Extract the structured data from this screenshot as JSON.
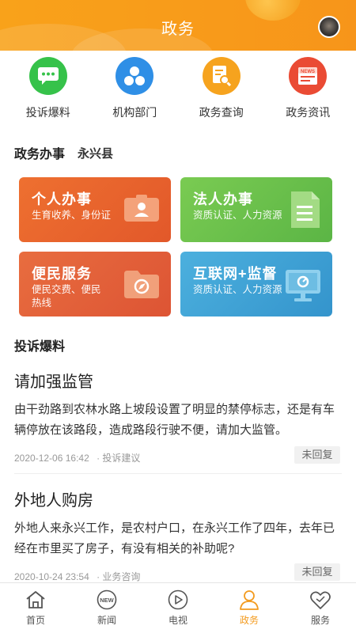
{
  "header": {
    "title": "政务"
  },
  "quick": [
    {
      "label": "投诉爆料",
      "icon": "chat-bubble-icon",
      "color": "#36c24a"
    },
    {
      "label": "机构部门",
      "icon": "org-circles-icon",
      "color": "#2f8fe6"
    },
    {
      "label": "政务查询",
      "icon": "document-search-icon",
      "color": "#f6a31e"
    },
    {
      "label": "政务资讯",
      "icon": "news-icon",
      "color": "#ea4b34"
    }
  ],
  "affairs": {
    "title": "政务办事",
    "county": "永兴县",
    "cards": [
      {
        "title": "个人办事",
        "desc": "生育收养、身份证",
        "icon": "id-card-icon",
        "color": "#e8602c"
      },
      {
        "title": "法人办事",
        "desc": "资质认证、人力资源",
        "icon": "document-icon",
        "color": "#6cc04a"
      },
      {
        "title": "便民服务",
        "desc": "便民交费、便民热线",
        "icon": "folder-icon",
        "color": "#e2603a"
      },
      {
        "title": "互联网+监督",
        "desc": "资质认证、人力资源",
        "icon": "monitor-icon",
        "color": "#3fa3d6"
      }
    ]
  },
  "complaints": {
    "title": "投诉爆料",
    "posts": [
      {
        "title": "请加强监管",
        "body": "由干劲路到农林水路上坡段设置了明显的禁停标志，还是有车辆停放在该路段，造成路段行驶不便，请加大监管。",
        "date": "2020-12-06 16:42",
        "category": "· 投诉建议",
        "status": "未回复"
      },
      {
        "title": "外地人购房",
        "body": "外地人来永兴工作，是农村户口，在永兴工作了四年，去年已经在市里买了房子，有没有相关的补助呢?",
        "date": "2020-10-24 23:54",
        "category": "· 业务咨询",
        "status": "未回复"
      }
    ]
  },
  "nav": [
    {
      "label": "首页",
      "icon": "home-icon"
    },
    {
      "label": "新闻",
      "icon": "news-badge-icon",
      "badge": "NEW"
    },
    {
      "label": "电视",
      "icon": "play-icon"
    },
    {
      "label": "政务",
      "icon": "person-icon",
      "active": true
    },
    {
      "label": "服务",
      "icon": "heart-icon"
    }
  ],
  "colors": {
    "accent": "#f39b1f"
  }
}
